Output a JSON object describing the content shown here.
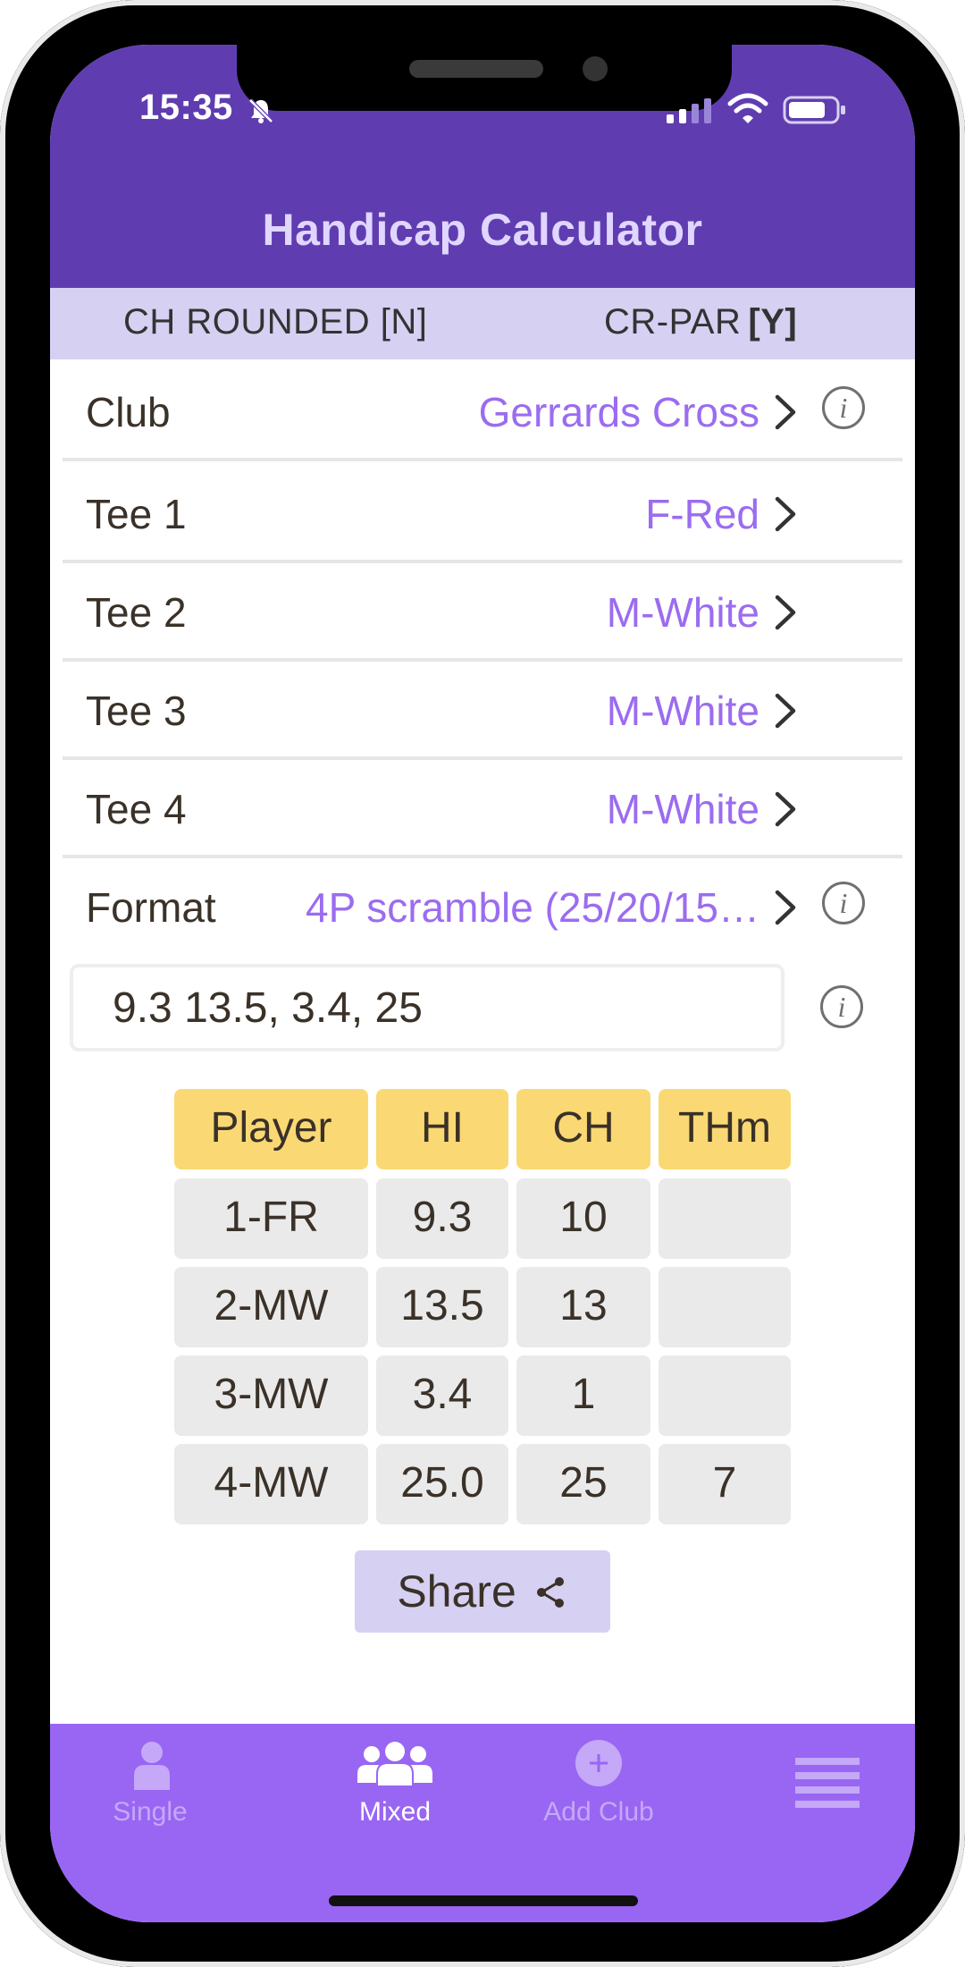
{
  "status_bar": {
    "time": "15:35"
  },
  "header": {
    "title": "Handicap Calculator"
  },
  "settings_bar": {
    "left": "CH ROUNDED [N]",
    "right_label": "CR-PAR",
    "right_value": "[Y]"
  },
  "rows": [
    {
      "label": "Club",
      "value": "Gerrards Cross",
      "has_info": true
    },
    {
      "label": "Tee 1",
      "value": "F-Red",
      "has_info": false
    },
    {
      "label": "Tee 2",
      "value": "M-White",
      "has_info": false
    },
    {
      "label": "Tee 3",
      "value": "M-White",
      "has_info": false
    },
    {
      "label": "Tee 4",
      "value": "M-White",
      "has_info": false
    },
    {
      "label": "Format",
      "value": "4P scramble (25/20/15…",
      "has_info": true
    }
  ],
  "handicap_input": {
    "value": "9.3 13.5, 3.4, 25"
  },
  "info_glyph": "i",
  "table": {
    "headers": [
      "Player",
      "HI",
      "CH",
      "THm"
    ],
    "rows": [
      [
        "1-FR",
        "9.3",
        "10",
        ""
      ],
      [
        "2-MW",
        "13.5",
        "13",
        ""
      ],
      [
        "3-MW",
        "3.4",
        "1",
        ""
      ],
      [
        "4-MW",
        "25.0",
        "25",
        "7"
      ]
    ]
  },
  "share": {
    "label": "Share"
  },
  "tabbar": {
    "tabs": [
      {
        "label": "Single",
        "active": false,
        "icon": "person-icon"
      },
      {
        "label": "Mixed",
        "active": true,
        "icon": "group-icon"
      },
      {
        "label": "Add Club",
        "active": false,
        "icon": "add-circle-icon"
      },
      {
        "label": "",
        "active": false,
        "icon": "menu-icon"
      }
    ]
  },
  "colors": {
    "header_purple": "#5f3db0",
    "tabbar_purple": "#9966f3",
    "accent_value": "#9b6cf0",
    "table_header": "#fad874",
    "table_cell": "#eaeaea",
    "settings_bar": "#d6d0f3"
  }
}
